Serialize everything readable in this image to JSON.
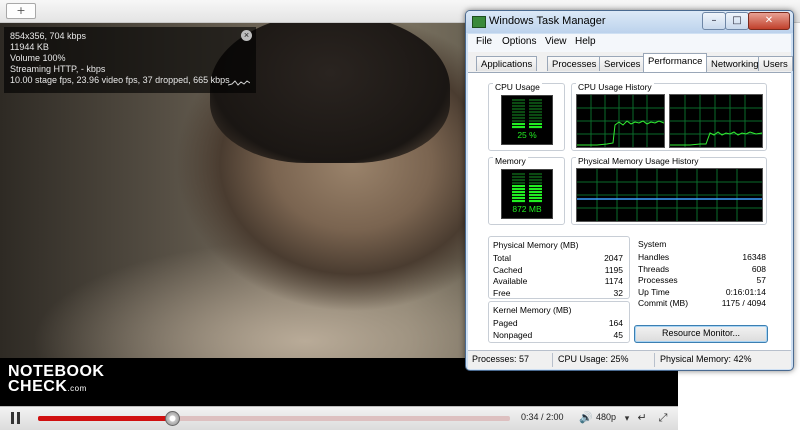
{
  "browser": {
    "tab_button_label": "+"
  },
  "video_info": {
    "lines": [
      "854x356, 704 kbps",
      "11944 KB",
      "Volume 100%",
      "Streaming HTTP, - kbps",
      "10.00 stage fps, 23.96 video fps, 37 dropped, 665 kbps"
    ],
    "close_label": "×"
  },
  "watermark": {
    "line1": "NOTEBOOK",
    "line2": "CHECK",
    "suffix": ".com"
  },
  "player": {
    "time": "0:34 / 2:00",
    "progress": 0.283,
    "quality": "480p",
    "colors": {
      "played": "#d01010",
      "buffered": "#ddc0c0"
    }
  },
  "task_manager": {
    "title": "Windows Task Manager",
    "window_buttons": {
      "minimize": "–",
      "maximize": "□",
      "close": "✕"
    },
    "menu": [
      "File",
      "Options",
      "View",
      "Help"
    ],
    "tabs": [
      "Applications",
      "Processes",
      "Services",
      "Performance",
      "Networking",
      "Users"
    ],
    "active_tab": "Performance",
    "cpu_usage": {
      "label": "CPU Usage",
      "value": "25 %",
      "fraction": 0.25
    },
    "cpu_history": {
      "label": "CPU Usage History"
    },
    "memory": {
      "label": "Memory",
      "value": "872 MB",
      "fraction": 0.42
    },
    "memory_history": {
      "label": "Physical Memory Usage History"
    },
    "physical_memory": {
      "title": "Physical Memory (MB)",
      "rows": [
        {
          "k": "Total",
          "v": "2047"
        },
        {
          "k": "Cached",
          "v": "1195"
        },
        {
          "k": "Available",
          "v": "1174"
        },
        {
          "k": "Free",
          "v": "32"
        }
      ]
    },
    "system": {
      "title": "System",
      "rows": [
        {
          "k": "Handles",
          "v": "16348"
        },
        {
          "k": "Threads",
          "v": "608"
        },
        {
          "k": "Processes",
          "v": "57"
        },
        {
          "k": "Up Time",
          "v": "0:16:01:14"
        },
        {
          "k": "Commit (MB)",
          "v": "1175 / 4094"
        }
      ]
    },
    "kernel_memory": {
      "title": "Kernel Memory (MB)",
      "rows": [
        {
          "k": "Paged",
          "v": "164"
        },
        {
          "k": "Nonpaged",
          "v": "45"
        }
      ]
    },
    "resource_monitor_label": "Resource Monitor...",
    "status": {
      "processes": "Processes: 57",
      "cpu": "CPU Usage: 25%",
      "memory": "Physical Memory: 42%"
    }
  }
}
